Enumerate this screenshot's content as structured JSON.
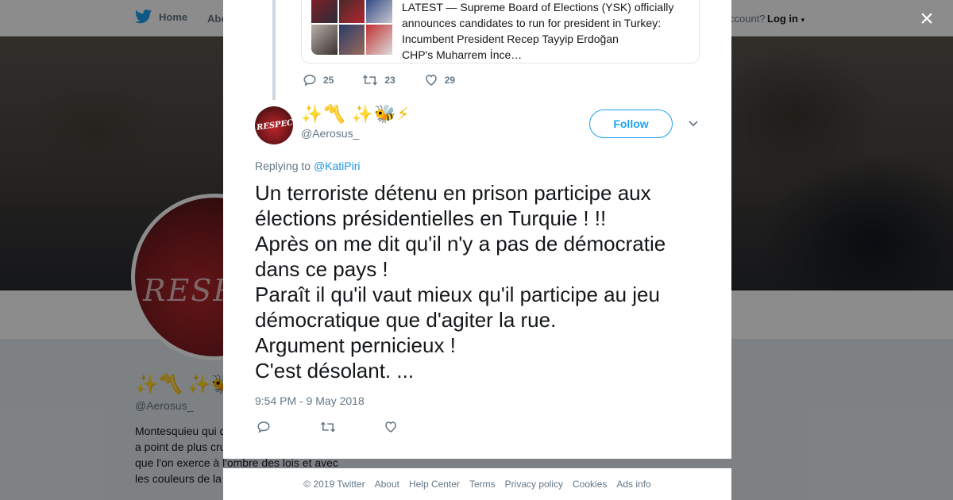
{
  "nav": {
    "home": "Home",
    "about": "Abo",
    "account": "ccount?",
    "login": "Log in"
  },
  "profile": {
    "avatar_text": "RESPECT",
    "name": "✨〽️ ✨🐝",
    "handle": "@Aerosus_",
    "bio_lines": [
      "Montesquieu qui d",
      "a point de plus cru",
      "que l'on exerce à l'ombre des lois et avec",
      "les couleurs de la"
    ]
  },
  "quoted": {
    "text_lines": [
      "LATEST — Supreme Board of Elections (YSK) officially",
      "announces candidates to run for president in Turkey:",
      "Incumbent President Recep Tayyip Erdoğan",
      "CHP's Muharrem İnce…"
    ],
    "replies": "25",
    "retweets": "23",
    "likes": "29"
  },
  "tweet": {
    "avatar_text": "RESPECT",
    "name": "✨〽️ ✨🐝⚡",
    "handle": "@Aerosus_",
    "follow_label": "Follow",
    "replying_prefix": "Replying to",
    "replying_to": "@KatiPiri",
    "lines": [
      "Un terroriste détenu en prison participe aux",
      "élections présidentielles en Turquie ! !!",
      "Après on me dit qu'il n'y a pas de démocratie",
      "dans ce pays !",
      "Paraît il qu'il vaut mieux qu'il participe au jeu",
      "démocratique que d'agiter la rue.",
      "Argument pernicieux !",
      "C'est désolant. ..."
    ],
    "timestamp": "9:54 PM - 9 May 2018"
  },
  "footer": {
    "copyright": "© 2019 Twitter",
    "about": "About",
    "help": "Help Center",
    "terms": "Terms",
    "privacy": "Privacy policy",
    "cookies": "Cookies",
    "ads": "Ads info"
  },
  "close_label": "×",
  "colors": {
    "accent": "#1da1f2",
    "link": "#1b95e0",
    "secondary_text": "#657786",
    "primary_text": "#14171a",
    "name_yellow": "#f5b800"
  }
}
